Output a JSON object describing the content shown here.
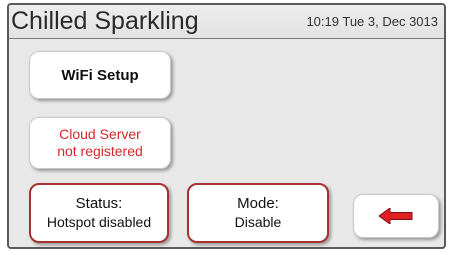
{
  "header": {
    "title": "Chilled Sparkling",
    "datetime": "10:19 Tue 3, Dec 3013"
  },
  "buttons": {
    "wifi_setup": "WiFi Setup",
    "cloud_server_line1": "Cloud Server",
    "cloud_server_line2": "not registered",
    "status_label": "Status:",
    "status_value": "Hotspot disabled",
    "mode_label": "Mode:",
    "mode_value": "Disable",
    "back_icon": "arrow-left-icon"
  },
  "colors": {
    "warning_text": "#d12a2a",
    "button_border_accent": "#a83232",
    "arrow": "#e02020"
  }
}
